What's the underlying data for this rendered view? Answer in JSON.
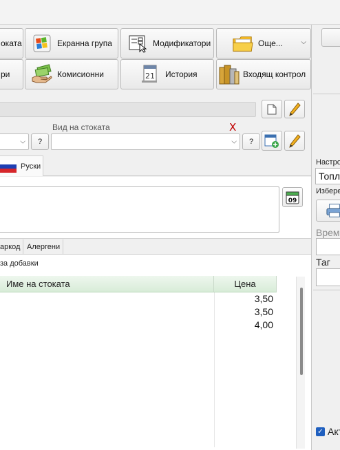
{
  "toolbar": {
    "row1": [
      {
        "name": "stock-button",
        "label": "оката",
        "icon": "stock-icon"
      },
      {
        "name": "screen-group-button",
        "label": "Екранна група",
        "icon": "windows-tiles-icon"
      },
      {
        "name": "modifiers-button",
        "label": "Модификатори",
        "icon": "modifiers-form-icon"
      },
      {
        "name": "general-button",
        "label": "Още...",
        "icon": "folder-icon"
      }
    ],
    "row2": [
      {
        "name": "categories-button",
        "label": "ри",
        "icon": "category-icon"
      },
      {
        "name": "commissions-button",
        "label": "Комисионни",
        "icon": "money-hand-icon"
      },
      {
        "name": "history-button",
        "label": "История",
        "icon": "history-calendar-icon"
      },
      {
        "name": "incoming-control-button",
        "label": "Входящ контрол",
        "icon": "books-icon"
      }
    ]
  },
  "form": {
    "stock_type_label": "Вид на стоката",
    "required_mark": "X",
    "question_label": "?"
  },
  "language_tab": {
    "label": "Руски",
    "icon": "russian-flag-icon"
  },
  "calendar_icon_text": "09",
  "subtabs": [
    "аркод",
    "Алергени"
  ],
  "filter_text": "за добавки",
  "grid": {
    "columns": [
      "Име на стоката",
      "Цена"
    ],
    "rows": [
      {
        "name": "",
        "price": "3,50"
      },
      {
        "name": "",
        "price": "3,50"
      },
      {
        "name": "",
        "price": "4,00"
      }
    ]
  },
  "right_panel": {
    "settings_label": "Настро",
    "settings_value": "Топл",
    "choose_label": "Избере",
    "time_label": "Време",
    "tag_label": "Таг",
    "active_label": "Акт"
  }
}
